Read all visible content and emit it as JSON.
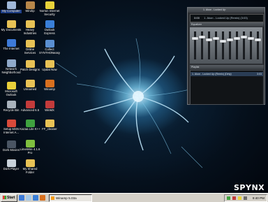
{
  "desktop_icons": [
    {
      "label": "My Computer",
      "icon": "computer-icon",
      "color": "#9fb7d8"
    },
    {
      "label": "My Documents",
      "icon": "folder-icon",
      "color": "#e8c255"
    },
    {
      "label": "The Internet",
      "icon": "ie-icon",
      "color": "#3d7ad8"
    },
    {
      "label": "Network Neighborhood",
      "icon": "network-icon",
      "color": "#8fa9c9"
    },
    {
      "label": "Microsoft Outlook",
      "icon": "outlook-icon",
      "color": "#e8cf3a"
    },
    {
      "label": "Recycle Bin",
      "icon": "recycle-bin-icon",
      "color": "#a9b3bd"
    },
    {
      "label": "Setup MSN Internet A...",
      "icon": "msn-icon",
      "color": "#d94a3a"
    },
    {
      "label": "Dork Movies",
      "icon": "movie-icon",
      "color": "#4a5563"
    },
    {
      "label": "Dork Player",
      "icon": "player-icon",
      "color": "#c9d2da"
    },
    {
      "label": "WinZip",
      "icon": "winzip-icon",
      "color": "#b8874a"
    },
    {
      "label": "Heavy Industries",
      "icon": "folder-icon",
      "color": "#e8c255"
    },
    {
      "label": "Online Services",
      "icon": "folder-icon",
      "color": "#e8c255"
    },
    {
      "label": "Patch Designs",
      "icon": "folder-icon",
      "color": "#e8c255"
    },
    {
      "label": "Unnamed",
      "icon": "folder-icon",
      "color": "#e8c255"
    },
    {
      "label": "Advanced 6.5",
      "icon": "app-icon",
      "color": "#c33b3b"
    },
    {
      "label": "Kazaa Lite K++",
      "icon": "kazaa-icon",
      "color": "#3fa23f"
    },
    {
      "label": "LimeWire 4.1.6 Pro",
      "icon": "limewire-icon",
      "color": "#7fbf3f"
    },
    {
      "label": "My Shared Folder",
      "icon": "shared-folder-icon",
      "color": "#e8c255"
    },
    {
      "label": "Norton Internet Security",
      "icon": "norton-icon",
      "color": "#e8d23a"
    },
    {
      "label": "Outlook Express",
      "icon": "outlook-express-icon",
      "color": "#3a7fd8"
    },
    {
      "label": "Collect SYNTHONeasy",
      "icon": "app-icon",
      "color": "#5a8fd1"
    },
    {
      "label": "Updat Now",
      "icon": "folder-icon",
      "color": "#e8c255"
    },
    {
      "label": "Winamp",
      "icon": "winamp-icon",
      "color": "#d8701f"
    },
    {
      "label": "WinMX",
      "icon": "winmx-icon",
      "color": "#c33b3b"
    },
    {
      "label": "FF_cleaner",
      "icon": "folder-icon",
      "color": "#e8c255"
    }
  ],
  "winamp": {
    "title": "1. Akon - Locked Up",
    "time": "0:00",
    "track_scroll": "1. Akon - Locked Up (Remix) (3:03)",
    "equalizer_title": "Equalizer",
    "playlist_title": "Playlist",
    "playlist_item": "1. Akon - Locked Up (Remix) (Dirty)",
    "playlist_item_time": "3:03"
  },
  "taskbar": {
    "start_label": "Start",
    "task_label": "Winamp 5.03a",
    "clock": "9:40 PM"
  },
  "wallpaper_logo": "SPYNX"
}
